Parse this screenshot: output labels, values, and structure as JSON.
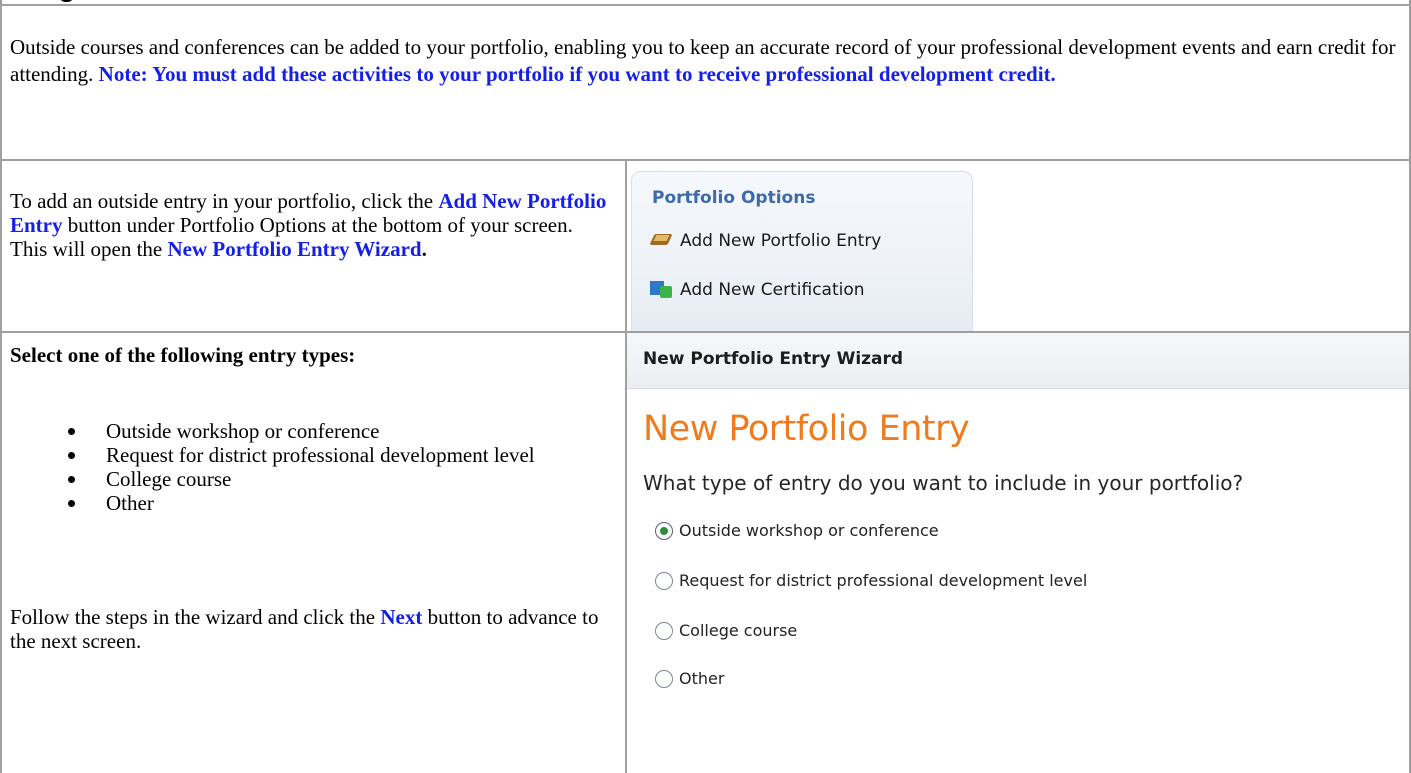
{
  "intro": {
    "text": "Outside courses and conferences can be added to your portfolio, enabling you to keep an accurate record of your professional development events and earn credit for attending.",
    "note": "Note: You must add these activities to your portfolio if you want to receive professional development credit."
  },
  "add_entry": {
    "text_1": "To add an outside entry in your portfolio, click the ",
    "highlight_1": "Add New Portfolio Entry",
    "text_2": " button under Portfolio Options at the bottom of your screen.",
    "text_3": "This will open the ",
    "highlight_2": "New Portfolio Entry Wizard",
    "period": "."
  },
  "portfolio_options": {
    "title": "Portfolio Options",
    "items": [
      {
        "label": "Add New Portfolio Entry",
        "icon": "book-icon"
      },
      {
        "label": "Add New Certification",
        "icon": "certification-icon"
      }
    ]
  },
  "entry_types": {
    "heading": "Select one of the following entry types:",
    "items": [
      "Outside workshop or conference",
      "Request for district professional development level",
      "College course",
      "Other"
    ],
    "follow_1": "Follow the steps in the wizard and click the ",
    "follow_highlight": "Next",
    "follow_2": " button to advance to the next screen."
  },
  "wizard": {
    "header": "New Portfolio Entry Wizard",
    "title": "New Portfolio Entry",
    "question": "What type of entry do you want to include in your portfolio?",
    "options": [
      {
        "label": "Outside workshop or conference",
        "selected": true
      },
      {
        "label": "Request for district professional development level",
        "selected": false
      },
      {
        "label": "College course",
        "selected": false
      },
      {
        "label": "Other",
        "selected": false
      }
    ]
  },
  "colors": {
    "highlight": "#1520e6",
    "wizard_title": "#f07b1e",
    "options_title": "#3d6aa8",
    "border": "#a0a0a0"
  }
}
